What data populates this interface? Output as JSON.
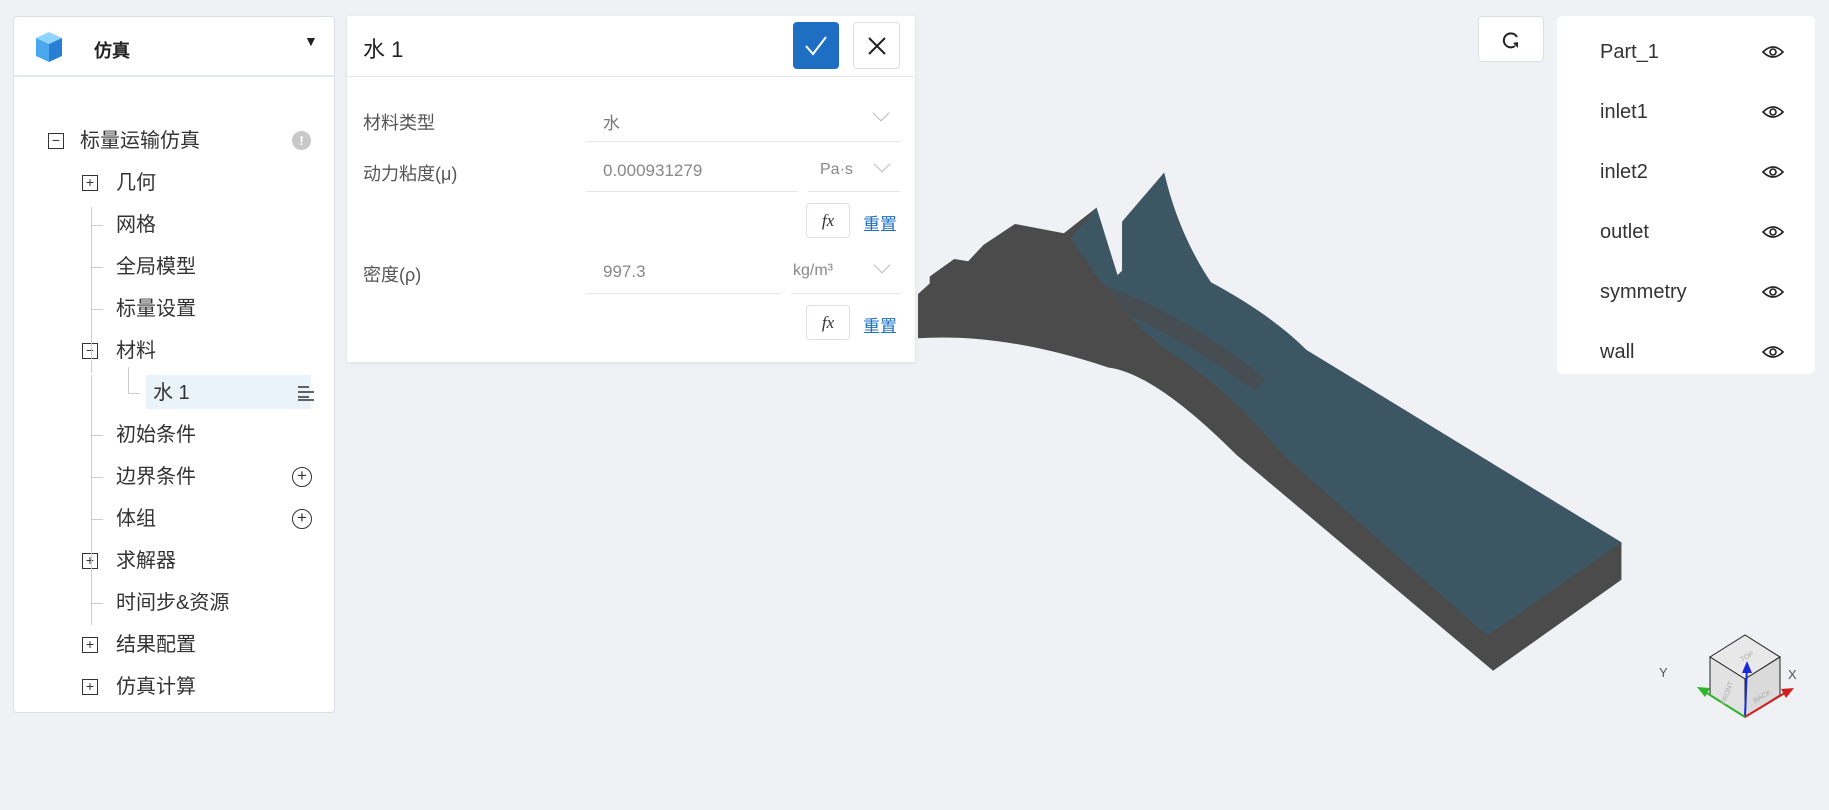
{
  "app": {
    "title": "仿真",
    "icon": "cube-logo-icon"
  },
  "tree": {
    "items": [
      {
        "label": "标量运输仿真",
        "expander": "minus",
        "badge": "!"
      },
      {
        "label": "几何",
        "expander": "plus"
      },
      {
        "label": "网格"
      },
      {
        "label": "全局模型"
      },
      {
        "label": "标量设置"
      },
      {
        "label": "材料",
        "expander": "minus"
      },
      {
        "label": "水 1",
        "selected": true
      },
      {
        "label": "初始条件"
      },
      {
        "label": "边界条件",
        "action": "+"
      },
      {
        "label": "体组",
        "action": "+"
      },
      {
        "label": "求解器",
        "expander": "plus"
      },
      {
        "label": "时间步&资源"
      },
      {
        "label": "结果配置",
        "expander": "plus"
      },
      {
        "label": "仿真计算",
        "expander": "plus"
      }
    ]
  },
  "dialog": {
    "title": "水 1",
    "confirm_icon": "check-icon",
    "close_icon": "close-icon",
    "material_type": {
      "label": "材料类型",
      "value": "水"
    },
    "viscosity": {
      "label": "动力粘度(μ)",
      "value": "0.000931279",
      "unit": "Pa·s",
      "fx": "fx",
      "reset": "重置"
    },
    "density": {
      "label": "密度(ρ)",
      "value": "997.3",
      "unit": "kg/m³",
      "fx": "fx",
      "reset": "重置"
    }
  },
  "parts": [
    {
      "label": "Part_1"
    },
    {
      "label": "inlet1"
    },
    {
      "label": "inlet2"
    },
    {
      "label": "outlet"
    },
    {
      "label": "symmetry"
    },
    {
      "label": "wall"
    }
  ],
  "axes": {
    "x": "X",
    "y": "Y",
    "faces": [
      "TOP",
      "FRONT",
      "BACK"
    ]
  },
  "colors": {
    "accent": "#1e6fc4",
    "model": "#4b4b4b",
    "mesh": "#3b5868"
  }
}
